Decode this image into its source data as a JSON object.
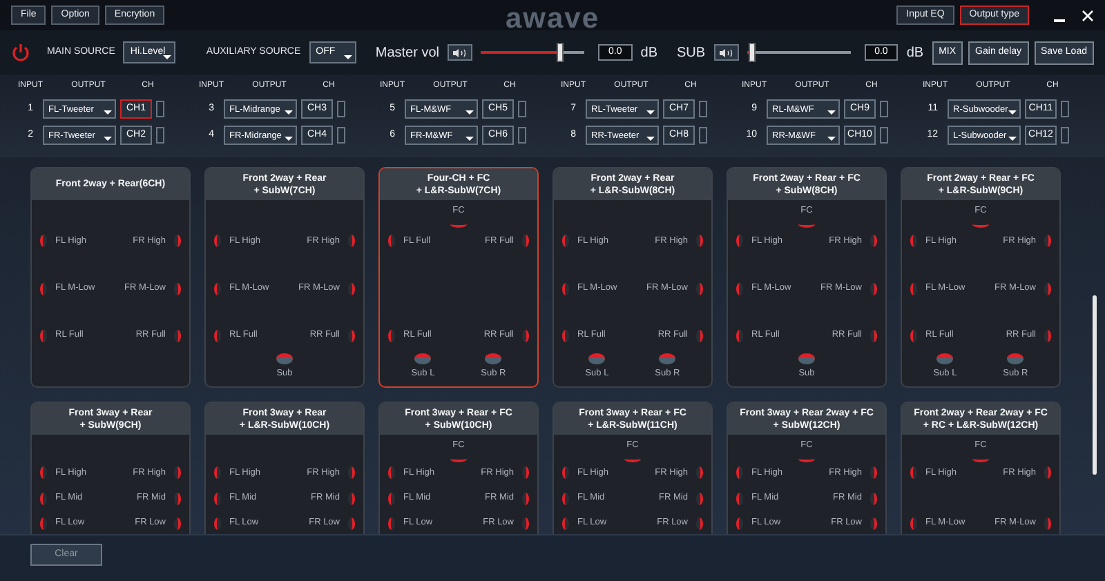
{
  "menu": [
    {
      "label": "File"
    },
    {
      "label": "Option"
    },
    {
      "label": "Encrytion"
    }
  ],
  "logo": "awave",
  "tabs": [
    {
      "label": "Input EQ",
      "selected": false
    },
    {
      "label": "Output type",
      "selected": true
    }
  ],
  "controls": {
    "main_source_label": "MAIN SOURCE",
    "main_source": "Hi.Level",
    "aux_source_label": "AUXILIARY SOURCE",
    "aux_source": "OFF",
    "master": {
      "label": "Master vol",
      "level": 0.78,
      "value": "0.0",
      "unit": "dB"
    },
    "sub": {
      "label": "SUB",
      "level": 0.02,
      "value": "0.0",
      "unit": "dB"
    },
    "buttons": [
      "MIX",
      "Gain delay",
      "Save Load"
    ]
  },
  "channel_groups": [
    {
      "headers": [
        "INPUT",
        "OUTPUT",
        "CH"
      ],
      "rows": [
        {
          "input": "1",
          "output": "FL-Tweeter",
          "ch": "CH1",
          "selected": true
        },
        {
          "input": "2",
          "output": "FR-Tweeter",
          "ch": "CH2",
          "selected": false
        }
      ]
    },
    {
      "headers": [
        "INPUT",
        "OUTPUT",
        "CH"
      ],
      "rows": [
        {
          "input": "3",
          "output": "FL-Midrange",
          "ch": "CH3",
          "selected": false
        },
        {
          "input": "4",
          "output": "FR-Midrange",
          "ch": "CH4",
          "selected": false
        }
      ]
    },
    {
      "headers": [
        "INPUT",
        "OUTPUT",
        "CH"
      ],
      "rows": [
        {
          "input": "5",
          "output": "FL-M&WF",
          "ch": "CH5",
          "selected": false
        },
        {
          "input": "6",
          "output": "FR-M&WF",
          "ch": "CH6",
          "selected": false
        }
      ]
    },
    {
      "headers": [
        "INPUT",
        "OUTPUT",
        "CH"
      ],
      "rows": [
        {
          "input": "7",
          "output": "RL-Tweeter",
          "ch": "CH7",
          "selected": false
        },
        {
          "input": "8",
          "output": "RR-Tweeter",
          "ch": "CH8",
          "selected": false
        }
      ]
    },
    {
      "headers": [
        "INPUT",
        "OUTPUT",
        "CH"
      ],
      "rows": [
        {
          "input": "9",
          "output": "RL-M&WF",
          "ch": "CH9",
          "selected": false
        },
        {
          "input": "10",
          "output": "RR-M&WF",
          "ch": "CH10",
          "selected": false
        }
      ]
    },
    {
      "headers": [
        "INPUT",
        "OUTPUT",
        "CH"
      ],
      "rows": [
        {
          "input": "11",
          "output": "R-Subwooder",
          "ch": "CH11",
          "selected": false
        },
        {
          "input": "12",
          "output": "L-Subwooder",
          "ch": "CH12",
          "selected": false
        }
      ]
    }
  ],
  "cards": [
    {
      "title_lines": [
        "Front 2way + Rear(6CH)"
      ],
      "selected": false,
      "rows": [
        [
          "FL High",
          "FR High"
        ],
        [
          "FL M-Low",
          "FR M-Low"
        ],
        [
          "RL Full",
          "RR Full"
        ]
      ]
    },
    {
      "title_lines": [
        "Front 2way + Rear",
        "+ SubW(7CH)"
      ],
      "selected": false,
      "rows": [
        [
          "FL High",
          "FR High"
        ],
        [
          "FL M-Low",
          "FR M-Low"
        ],
        [
          "RL Full",
          "RR Full"
        ]
      ],
      "subs": [
        "Sub"
      ]
    },
    {
      "title_lines": [
        "Four-CH + FC",
        "+ L&R-SubW(7CH)"
      ],
      "selected": true,
      "center": "FC",
      "rows": [
        [
          "FL Full",
          "FR Full"
        ],
        [
          "RL Full",
          "RR Full"
        ]
      ],
      "subs": [
        "Sub L",
        "Sub R"
      ]
    },
    {
      "title_lines": [
        "Front 2way + Rear",
        "+ L&R-SubW(8CH)"
      ],
      "selected": false,
      "rows": [
        [
          "FL High",
          "FR High"
        ],
        [
          "FL M-Low",
          "FR M-Low"
        ],
        [
          "RL Full",
          "RR Full"
        ]
      ],
      "subs": [
        "Sub L",
        "Sub R"
      ]
    },
    {
      "title_lines": [
        "Front 2way + Rear + FC",
        "+ SubW(8CH)"
      ],
      "selected": false,
      "center": "FC",
      "rows": [
        [
          "FL High",
          "FR High"
        ],
        [
          "FL M-Low",
          "FR M-Low"
        ],
        [
          "RL Full",
          "RR Full"
        ]
      ],
      "subs": [
        "Sub"
      ]
    },
    {
      "title_lines": [
        "Front 2way + Rear + FC",
        "+ L&R-SubW(9CH)"
      ],
      "selected": false,
      "center": "FC",
      "rows": [
        [
          "FL High",
          "FR High"
        ],
        [
          "FL M-Low",
          "FR M-Low"
        ],
        [
          "RL Full",
          "RR Full"
        ]
      ],
      "subs": [
        "Sub L",
        "Sub R"
      ]
    },
    {
      "title_lines": [
        "Front 3way + Rear",
        "+ SubW(9CH)"
      ],
      "selected": false,
      "rows": [
        [
          "FL High",
          "FR High"
        ],
        [
          "FL Mid",
          "FR Mid"
        ],
        [
          "FL Low",
          "FR Low"
        ]
      ]
    },
    {
      "title_lines": [
        "Front 3way + Rear",
        "+ L&R-SubW(10CH)"
      ],
      "selected": false,
      "rows": [
        [
          "FL High",
          "FR High"
        ],
        [
          "FL Mid",
          "FR Mid"
        ],
        [
          "FL Low",
          "FR Low"
        ]
      ]
    },
    {
      "title_lines": [
        "Front 3way + Rear + FC",
        "+ SubW(10CH)"
      ],
      "selected": false,
      "center": "FC",
      "rows": [
        [
          "FL High",
          "FR High"
        ],
        [
          "FL Mid",
          "FR Mid"
        ],
        [
          "FL Low",
          "FR Low"
        ]
      ]
    },
    {
      "title_lines": [
        "Front 3way + Rear + FC",
        "+ L&R-SubW(11CH)"
      ],
      "selected": false,
      "center": "FC",
      "rows": [
        [
          "FL High",
          "FR High"
        ],
        [
          "FL Mid",
          "FR Mid"
        ],
        [
          "FL Low",
          "FR Low"
        ]
      ]
    },
    {
      "title_lines": [
        "Front 3way + Rear 2way + FC",
        "+ SubW(12CH)"
      ],
      "selected": false,
      "center": "FC",
      "rows": [
        [
          "FL High",
          "FR High"
        ],
        [
          "FL Mid",
          "FR Mid"
        ],
        [
          "FL Low",
          "FR Low"
        ]
      ]
    },
    {
      "title_lines": [
        "Front 2way + Rear 2way + FC",
        "+ RC + L&R-SubW(12CH)"
      ],
      "selected": false,
      "center": "FC",
      "rows": [
        [
          "FL High",
          "FR High"
        ],
        [
          "FL M-Low",
          "FR M-Low"
        ]
      ]
    }
  ],
  "footer": {
    "clear": "Clear"
  }
}
